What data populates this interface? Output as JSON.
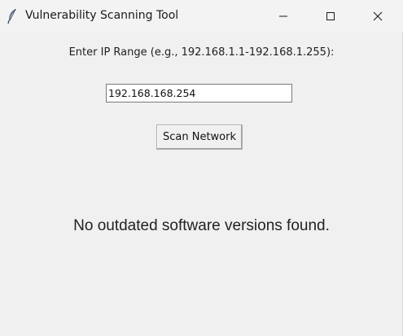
{
  "window": {
    "title": "Vulnerability Scanning Tool",
    "app_icon": "feather-icon",
    "controls": {
      "minimize_icon": "minimize-icon",
      "maximize_icon": "maximize-icon",
      "close_icon": "close-icon"
    }
  },
  "form": {
    "prompt_label": "Enter IP Range (e.g., 192.168.1.1-192.168.1.255):",
    "ip_value": "192.168.168.254",
    "scan_button_label": "Scan Network"
  },
  "result": {
    "message": "No outdated software versions found."
  }
}
